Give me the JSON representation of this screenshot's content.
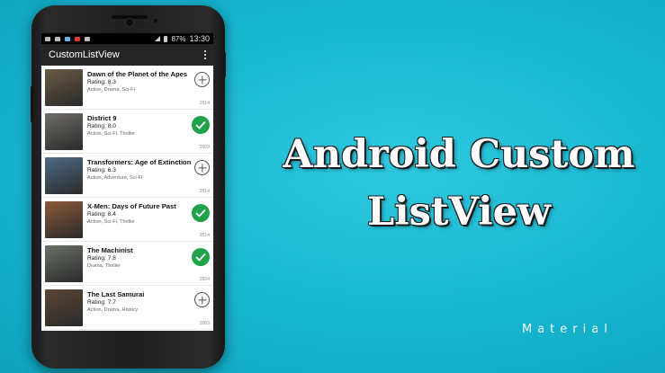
{
  "status_bar": {
    "battery": "87%",
    "time": "13:30"
  },
  "app_bar": {
    "title": "CustomListView",
    "overflow_icon": "more-vert-icon"
  },
  "movies": [
    {
      "title": "Dawn of the Planet of the Apes",
      "rating": "Rating: 8.3",
      "genre": "Action, Drama, Sci-Fi",
      "year": "2014",
      "state": "add",
      "thumb": "#6b5a45"
    },
    {
      "title": "District 9",
      "rating": "Rating: 8.0",
      "genre": "Action, Sci-Fi, Thriller",
      "year": "2009",
      "state": "added",
      "thumb": "#6f6d66"
    },
    {
      "title": "Transformers: Age of Extinction",
      "rating": "Rating: 6.3",
      "genre": "Action, Adventure, Sci-Fi",
      "year": "2014",
      "state": "add",
      "thumb": "#4f6b86"
    },
    {
      "title": "X-Men: Days of Future Past",
      "rating": "Rating: 8.4",
      "genre": "Action, Sci-Fi, Thriller",
      "year": "2014",
      "state": "added",
      "thumb": "#8b5a3a"
    },
    {
      "title": "The Machinist",
      "rating": "Rating: 7.8",
      "genre": "Drama, Thriller",
      "year": "2004",
      "state": "added",
      "thumb": "#6a7166"
    },
    {
      "title": "The Last Samurai",
      "rating": "Rating: 7.7",
      "genre": "Action, Drama, History",
      "year": "2003",
      "state": "add",
      "thumb": "#5b4634"
    }
  ],
  "headline": {
    "line1": "Android Custom",
    "line2": "ListView"
  },
  "tag": "Material",
  "colors": {
    "background": "#16b4cf",
    "added": "#1fa24a",
    "appbar": "#262626"
  }
}
